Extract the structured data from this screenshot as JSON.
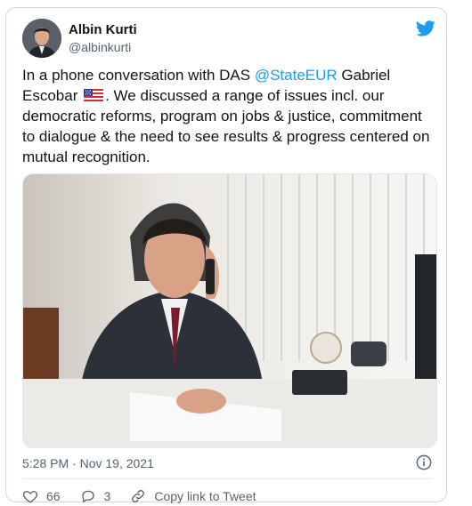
{
  "tweet": {
    "author_name": "Albin Kurti",
    "author_handle": "@albinkurti",
    "text_before_mention": "In a phone conversation with DAS ",
    "mention": "@StateEUR",
    "text_after_mention": " Gabriel Escobar",
    "flag_icon": "us-flag-icon",
    "text_after_flag": ". We discussed a range of issues incl. our democratic reforms, program on jobs & justice, commitment to dialogue & the need to see results & progress centered on mutual recognition.",
    "timestamp": "5:28 PM · Nov 19, 2021"
  },
  "actions": {
    "like_count": "66",
    "reply_count": "3",
    "copy_link_label": "Copy link to Tweet"
  },
  "colors": {
    "accent": "#1d9bf0",
    "text": "#0f1419",
    "muted": "#536471"
  }
}
